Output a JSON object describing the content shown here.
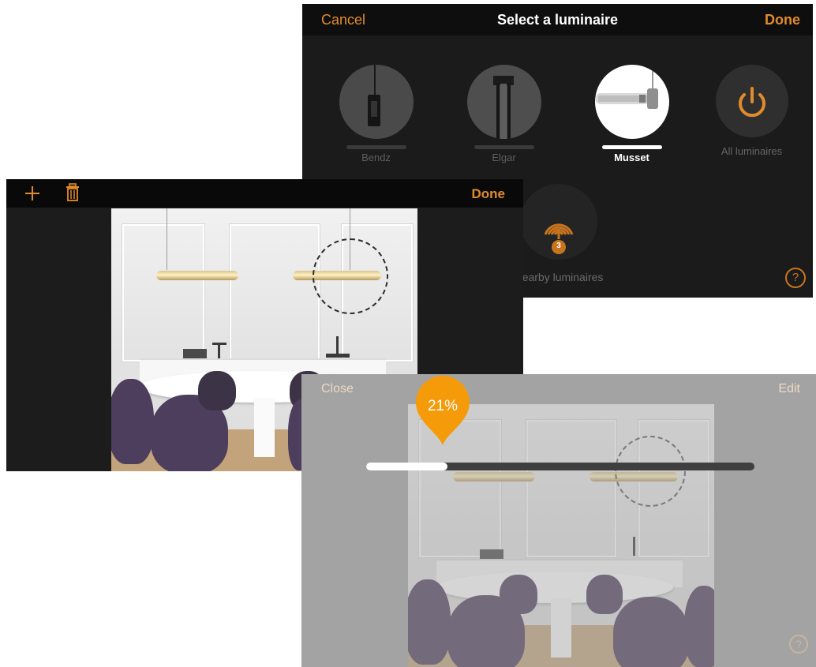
{
  "select_panel": {
    "title": "Select a luminaire",
    "cancel_label": "Cancel",
    "done_label": "Done",
    "luminaires": [
      {
        "label": "Bendz",
        "selected": false
      },
      {
        "label": "Elgar",
        "selected": false
      },
      {
        "label": "Musset",
        "selected": true
      },
      {
        "label": "All luminaires",
        "icon": "power-icon"
      }
    ],
    "nearby": {
      "label": "Nearby luminaires",
      "count": "3",
      "icon": "wireless-signal-icon"
    },
    "help_icon": "question-icon"
  },
  "edit_panel": {
    "add_icon": "plus-icon",
    "delete_icon": "trash-icon",
    "done_label": "Done"
  },
  "dimmer_panel": {
    "close_label": "Close",
    "edit_label": "Edit",
    "brightness_label": "21%",
    "brightness_value": 21,
    "help_icon": "question-icon"
  },
  "colors": {
    "accent": "#e28b2b",
    "bubble": "#f59b0a",
    "dark_bg": "#1b1b1b",
    "dimmer_bg": "#a3a3a3"
  }
}
